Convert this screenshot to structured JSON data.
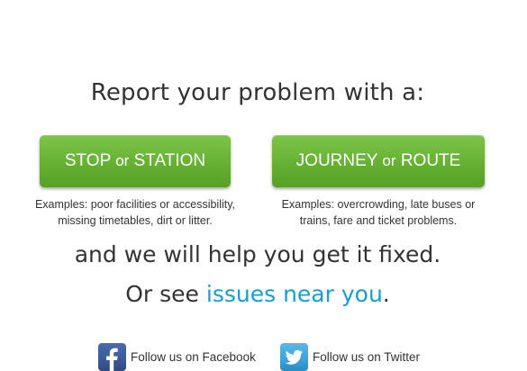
{
  "headline": "Report your problem with a:",
  "stop_button": {
    "label_part1": "STOP",
    "label_or": "or",
    "label_part2": "STATION",
    "examples_line1": "Examples: poor facilities or accessibility,",
    "examples_line2": "missing timetables, dirt or litter."
  },
  "journey_button": {
    "label_part1": "JOURNEY",
    "label_or": "or",
    "label_part2": "ROUTE",
    "examples_line1": "Examples: overcrowding, late buses or",
    "examples_line2": "trains, fare and ticket problems."
  },
  "help_line": "and we will help you get it fixed.",
  "see_line": {
    "prefix": "Or see ",
    "link": "issues near you",
    "suffix": "."
  },
  "social": {
    "facebook": {
      "label": "Follow us on Facebook",
      "icon": "facebook-icon"
    },
    "twitter": {
      "label": "Follow us on Twitter",
      "icon": "twitter-icon"
    }
  },
  "colors": {
    "button_green": "#68b335",
    "link_blue": "#1b9ccf",
    "facebook_blue": "#3b5998",
    "twitter_blue": "#3aa3d8",
    "text": "#333333"
  }
}
